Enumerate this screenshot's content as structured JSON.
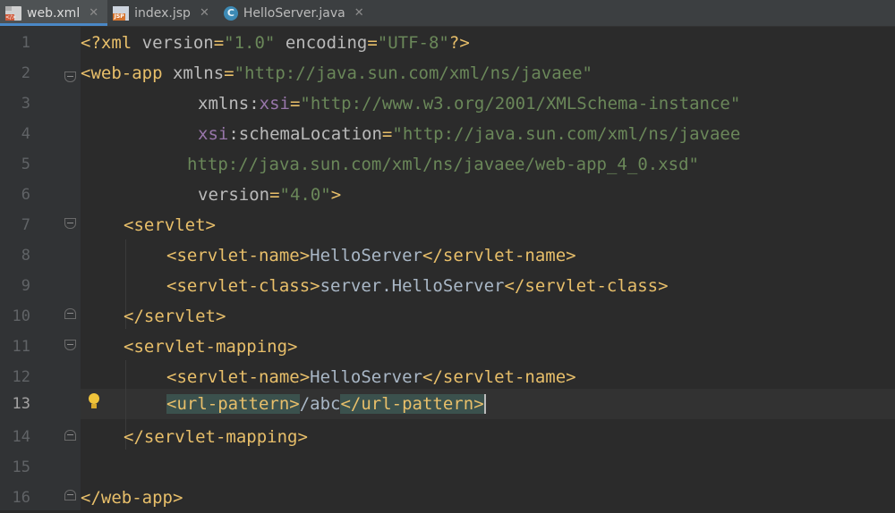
{
  "tabs": [
    {
      "label": "web.xml",
      "icon": "xml-file-icon",
      "active": true,
      "closable": true
    },
    {
      "label": "index.jsp",
      "icon": "jsp-file-icon",
      "active": false,
      "closable": true
    },
    {
      "label": "HelloServer.java",
      "icon": "java-class-icon",
      "active": false,
      "closable": true
    }
  ],
  "tab_icon_text": {
    "xml_badge": "</>",
    "jsp_badge": "JSP",
    "java_letter": "C"
  },
  "editor": {
    "current_line": 13,
    "lines": [
      {
        "n": "1"
      },
      {
        "n": "2"
      },
      {
        "n": "3"
      },
      {
        "n": "4"
      },
      {
        "n": "5"
      },
      {
        "n": "6"
      },
      {
        "n": "7"
      },
      {
        "n": "8"
      },
      {
        "n": "9"
      },
      {
        "n": "10"
      },
      {
        "n": "11"
      },
      {
        "n": "12"
      },
      {
        "n": "13"
      },
      {
        "n": "14"
      },
      {
        "n": "15"
      },
      {
        "n": "16"
      }
    ],
    "code": {
      "l1_decl_open": "<?xml ",
      "l1_version_attr": "version",
      "l1_eq1": "=",
      "l1_version_val": "\"1.0\"",
      "l1_space": " ",
      "l1_encoding_attr": "encoding",
      "l1_eq2": "=",
      "l1_encoding_val": "\"UTF-8\"",
      "l1_decl_close": "?>",
      "l2_open": "<web-app ",
      "l2_attr": "xmlns",
      "l2_eq": "=",
      "l2_val": "\"http://java.sun.com/xml/ns/javaee\"",
      "l3_attr": "xmlns:",
      "l3_ns": "xsi",
      "l3_eq": "=",
      "l3_val": "\"http://www.w3.org/2001/XMLSchema-instance\"",
      "l4_ns": "xsi",
      "l4_attr": ":schemaLocation",
      "l4_eq": "=",
      "l4_val": "\"http://java.sun.com/xml/ns/javaee",
      "l5_val": "http://java.sun.com/xml/ns/javaee/web-app_4_0.xsd\"",
      "l6_attr": "version",
      "l6_eq": "=",
      "l6_val": "\"4.0\"",
      "l6_close": ">",
      "l7": "<servlet>",
      "l8_open": "<servlet-name>",
      "l8_text": "HelloServer",
      "l8_close": "</servlet-name>",
      "l9_open": "<servlet-class>",
      "l9_text": "server.HelloServer",
      "l9_close": "</servlet-class>",
      "l10": "</servlet>",
      "l11": "<servlet-mapping>",
      "l12_open": "<servlet-name>",
      "l12_text": "HelloServer",
      "l12_close": "</servlet-name>",
      "l13_open": "<url-pattern>",
      "l13_text": "/abc",
      "l13_close": "</url-pattern>",
      "l14": "</servlet-mapping>",
      "l16": "</web-app>"
    }
  },
  "colors": {
    "background": "#2b2b2b",
    "gutter": "#313335",
    "tag": "#e8bf6a",
    "attribute": "#bababa",
    "string": "#6a8759",
    "namespace": "#9876aa",
    "text": "#a9b7c6",
    "tab_active_underline": "#4a88c7"
  }
}
